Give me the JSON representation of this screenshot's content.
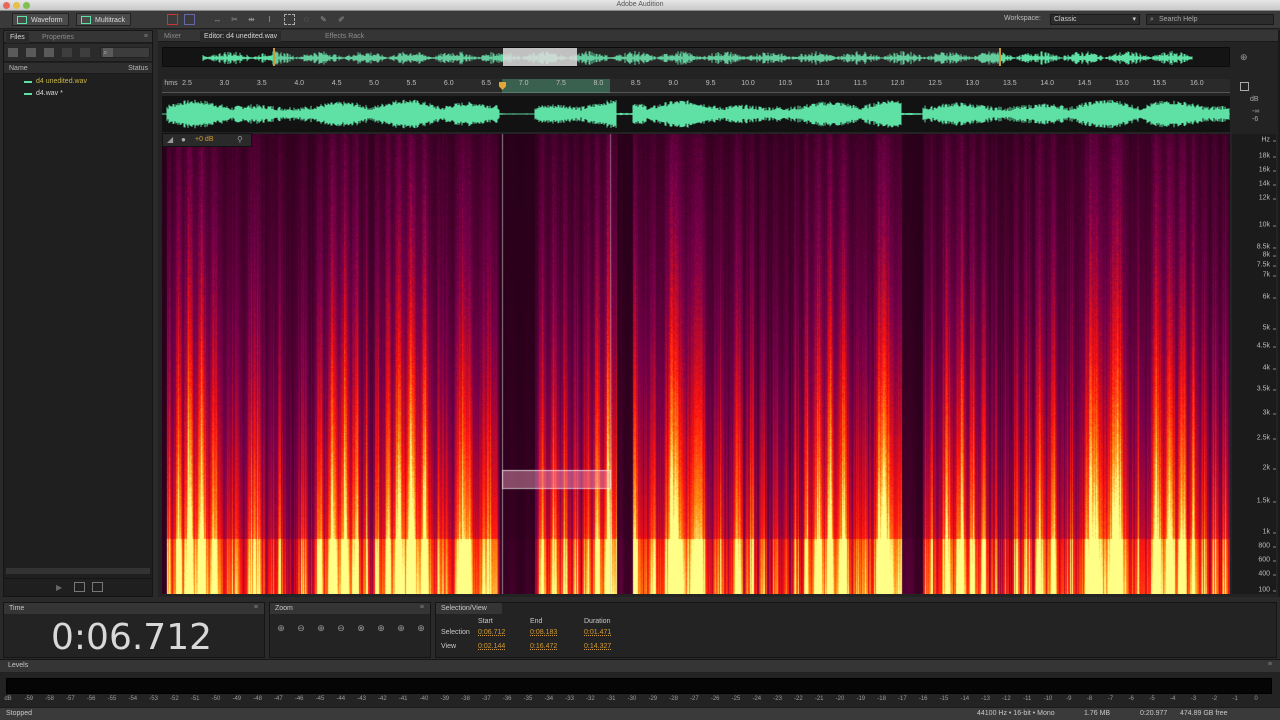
{
  "window": {
    "title": "Adobe Audition"
  },
  "toolbar": {
    "waveform_label": "Waveform",
    "multitrack_label": "Multitrack",
    "workspace_label": "Workspace:",
    "workspace_value": "Classic",
    "search_placeholder": "Search Help"
  },
  "files_panel": {
    "tabs": [
      "Files",
      "Properties"
    ],
    "col_name": "Name",
    "col_status": "Status",
    "items": [
      {
        "label": "d4 unedited.wav"
      },
      {
        "label": "d4.wav *"
      }
    ]
  },
  "editor": {
    "tabs": [
      "Mixer",
      "Editor: d4 unedited.wav",
      "Effects Rack"
    ],
    "ruler_unit": "hms",
    "ruler_ticks": [
      "2.5",
      "3.0",
      "3.5",
      "4.0",
      "4.5",
      "5.0",
      "5.5",
      "6.0",
      "6.5",
      "7.0",
      "7.5",
      "8.0",
      "8.5",
      "9.0",
      "9.5",
      "10.0",
      "10.5",
      "11.0",
      "11.5",
      "12.0",
      "12.5",
      "13.0",
      "13.5",
      "14.0",
      "14.5",
      "15.0",
      "15.5",
      "16.0"
    ],
    "db_labels": [
      "dB",
      "-∞",
      "-6"
    ],
    "gain": "+0 dB",
    "hz_labels": [
      "Hz",
      "18k",
      "16k",
      "14k",
      "12k",
      "10k",
      "8.5k",
      "8k",
      "7.5k",
      "7k",
      "6k",
      "5k",
      "4.5k",
      "4k",
      "3.5k",
      "3k",
      "2.5k",
      "2k",
      "1.5k",
      "1k",
      "800",
      "600",
      "400",
      "100"
    ]
  },
  "time_panel": {
    "title": "Time",
    "value": "0:06.712"
  },
  "zoom_panel": {
    "title": "Zoom"
  },
  "selection_panel": {
    "title": "Selection/View",
    "col_start": "Start",
    "col_end": "End",
    "col_duration": "Duration",
    "selection_label": "Selection",
    "view_label": "View",
    "selection_start": "0:06.712",
    "selection_end": "0:08.183",
    "selection_duration": "0:01.471",
    "view_start": "0:02.144",
    "view_end": "0:16.472",
    "view_duration": "0:14.327"
  },
  "levels": {
    "title": "Levels",
    "scale": [
      "dB",
      "-59",
      "-58",
      "-57",
      "-56",
      "-55",
      "-54",
      "-53",
      "-52",
      "-51",
      "-50",
      "-49",
      "-48",
      "-47",
      "-46",
      "-45",
      "-44",
      "-43",
      "-42",
      "-41",
      "-40",
      "-39",
      "-38",
      "-37",
      "-36",
      "-35",
      "-34",
      "-33",
      "-32",
      "-31",
      "-30",
      "-29",
      "-28",
      "-27",
      "-26",
      "-25",
      "-24",
      "-23",
      "-22",
      "-21",
      "-20",
      "-19",
      "-18",
      "-17",
      "-16",
      "-15",
      "-14",
      "-13",
      "-12",
      "-11",
      "-10",
      "-9",
      "-8",
      "-7",
      "-6",
      "-5",
      "-4",
      "-3",
      "-2",
      "-1",
      "0"
    ]
  },
  "status": {
    "state": "Stopped",
    "format": "44100 Hz • 16-bit • Mono",
    "size": "1.76 MB",
    "duration": "0:20.977",
    "free": "474.89 GB free"
  },
  "colors": {
    "waveform": "#5fe0a5",
    "accent": "#d49a34"
  }
}
